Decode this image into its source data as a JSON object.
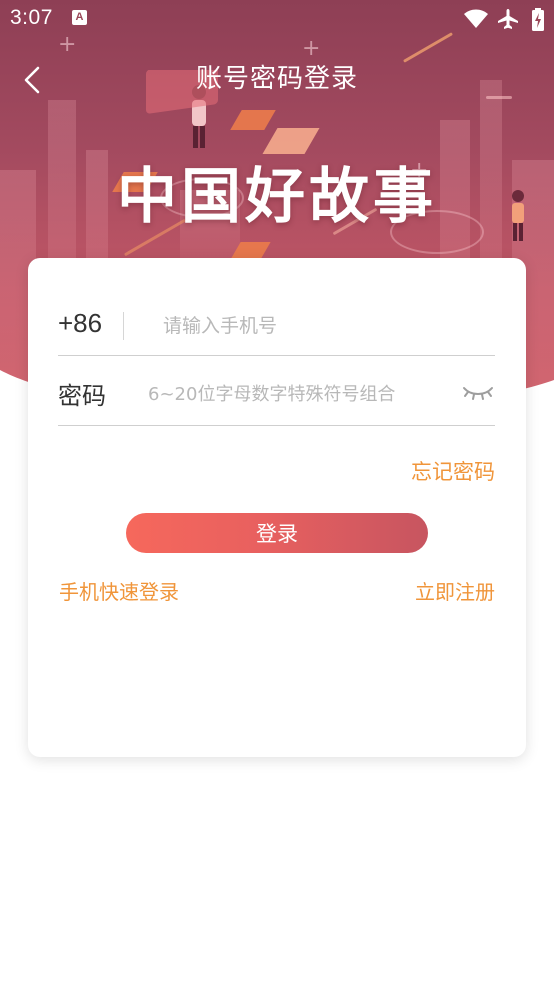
{
  "status_bar": {
    "time": "3:07",
    "app_icon_letter": "A",
    "icons": [
      "wifi-icon",
      "airplane-mode-icon",
      "battery-charging-icon"
    ]
  },
  "header": {
    "title": "账号密码登录",
    "back_icon": "chevron-left-icon"
  },
  "hero": {
    "brand_title": "中国好故事"
  },
  "login_form": {
    "country_code": "+86",
    "phone_placeholder": "请输入手机号",
    "phone_value": "",
    "password_label": "密码",
    "password_placeholder": "6~20位字母数字特殊符号组合",
    "password_value": "",
    "password_toggle_icon": "eye-closed-icon",
    "forgot_password": "忘记密码",
    "login_button": "登录",
    "quick_login": "手机快速登录",
    "register": "立即注册"
  },
  "colors": {
    "accent_orange": "#f0953a",
    "hero_top": "#8e3f55",
    "hero_bottom": "#d06069",
    "button_start": "#f6685c",
    "button_end": "#c75560"
  }
}
